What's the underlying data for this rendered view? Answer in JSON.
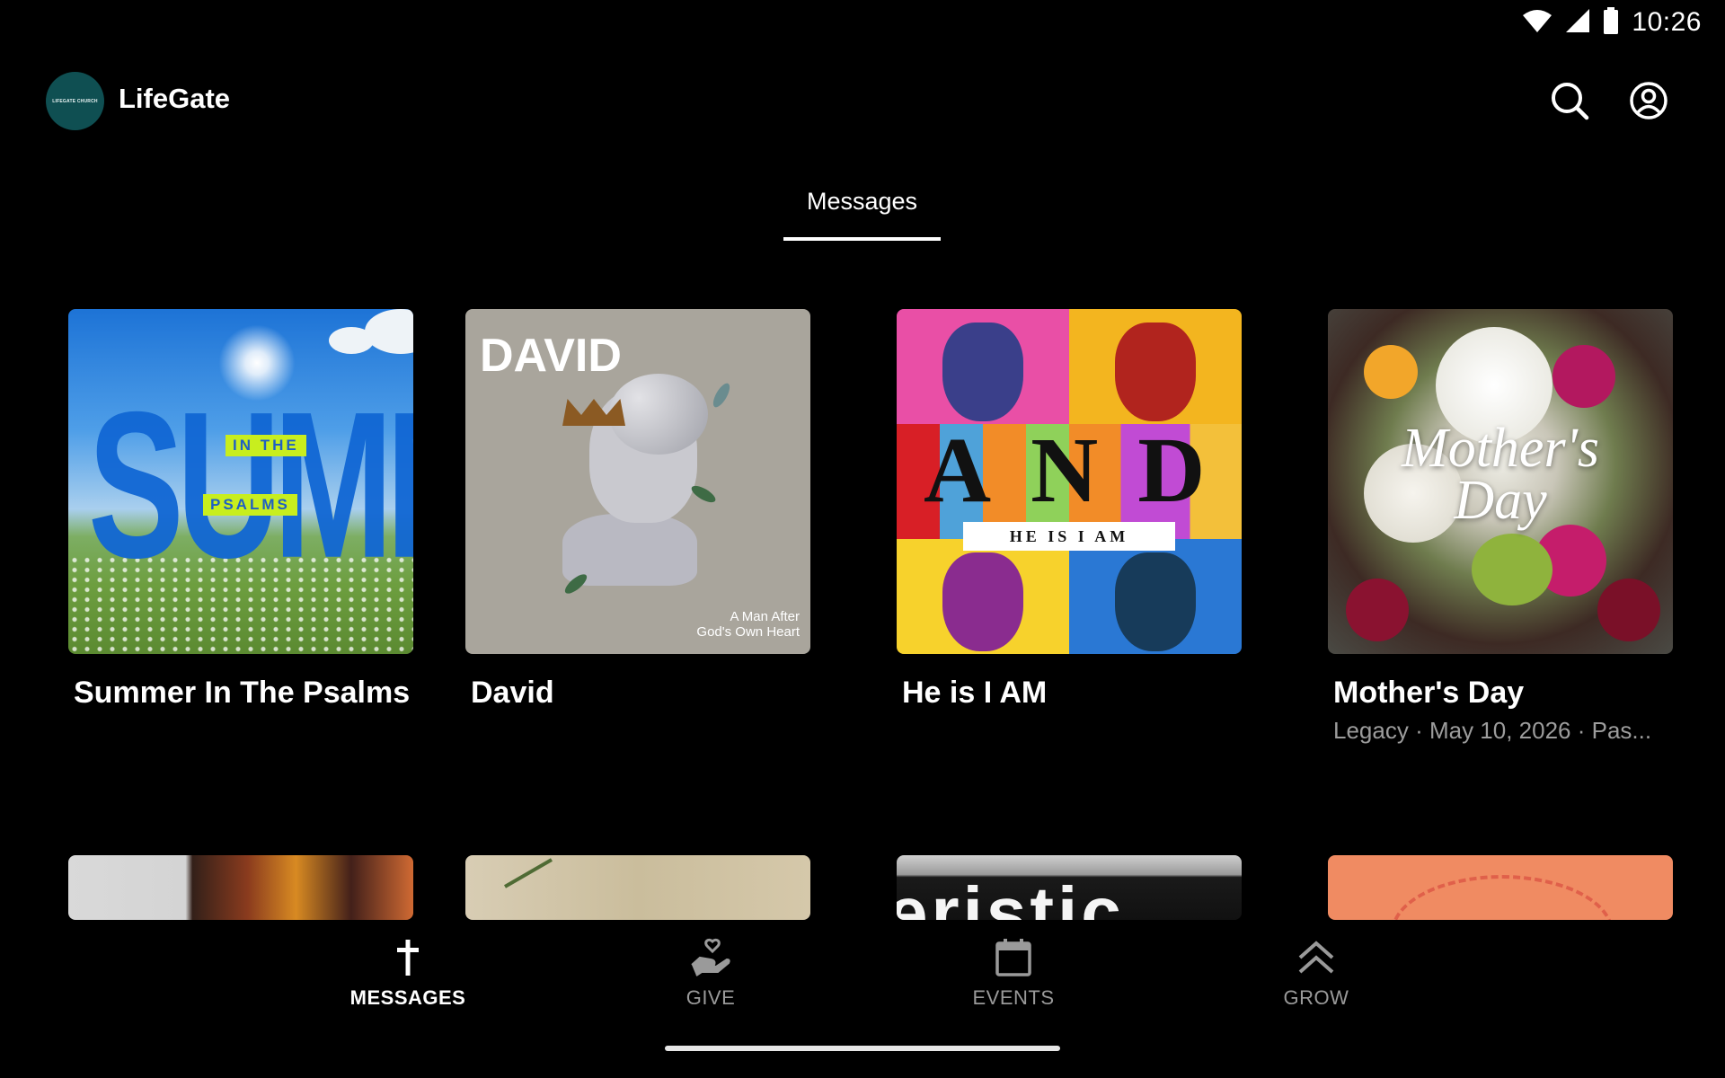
{
  "status_bar": {
    "time": "10:26",
    "icons": [
      "wifi-icon",
      "cell-signal-icon",
      "battery-icon"
    ]
  },
  "app_bar": {
    "title": "LifeGate",
    "logo_text": "LIFEGATE CHURCH",
    "actions": [
      "search-icon",
      "account-icon"
    ]
  },
  "tabs": [
    {
      "label": "Messages",
      "selected": true
    }
  ],
  "series": [
    {
      "title": "Summer In The Psalms",
      "subtitle": "",
      "art": {
        "headline": "SUMMER",
        "tag1": "IN THE",
        "tag2": "PSALMS"
      }
    },
    {
      "title": "David",
      "subtitle": "",
      "art": {
        "headline": "DAVID",
        "tagline_1": "A Man After",
        "tagline_2": "God's Own Heart"
      }
    },
    {
      "title": "He is I AM",
      "subtitle": "",
      "art": {
        "headline": "AND",
        "banner": "HE IS I AM"
      }
    },
    {
      "title": "Mother's Day",
      "subtitle": "Legacy · May 10, 2026 · Pas...",
      "art": {
        "line1": "Mother's",
        "line2": "Day"
      }
    }
  ],
  "second_row_art": {
    "r3_text": "eristic"
  },
  "bottom_nav": [
    {
      "label": "MESSAGES",
      "icon": "cross-icon",
      "active": true
    },
    {
      "label": "GIVE",
      "icon": "hand-heart-icon",
      "active": false
    },
    {
      "label": "EVENTS",
      "icon": "calendar-icon",
      "active": false
    },
    {
      "label": "GROW",
      "icon": "double-chevron-up-icon",
      "active": false
    }
  ],
  "colors": {
    "background": "#000000",
    "text": "#ffffff",
    "muted": "#9a9a9a",
    "logo_bg": "#0f4f52"
  }
}
